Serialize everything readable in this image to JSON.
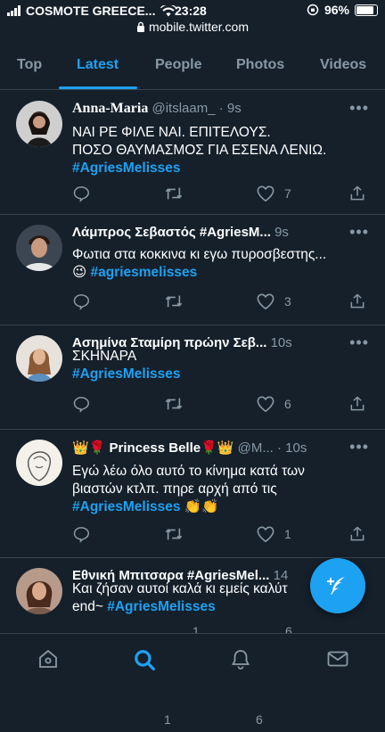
{
  "status_bar": {
    "carrier": "COSMOTE GREECE...",
    "time": "23:28",
    "battery": "96%",
    "battery_level": 0.96
  },
  "url": "mobile.twitter.com",
  "tabs": [
    {
      "label": "Top"
    },
    {
      "label": "Latest",
      "active": true
    },
    {
      "label": "People"
    },
    {
      "label": "Photos"
    },
    {
      "label": "Videos"
    }
  ],
  "tweets": [
    {
      "name": "Anna-Maria",
      "meta": "@itslaam_ · 9s",
      "lines": [
        "ΝΑΙ ΡΕ ΦΙΛΕ ΝΑΙ. ΕΠΙΤΕΛΟΥΣ.",
        "ΠΟΣΟ ΘΑΥΜΑΣΜΟΣ ΓΙΑ ΕΣΕΝΑ ΛΕΝΙΩ."
      ],
      "hashtag": "#AgriesMelisses",
      "likes": "7"
    },
    {
      "name": "Λάμπρος Σεβαστός #AgriesM...",
      "meta": "9s",
      "lines": [
        "Φωτια στα κοκκινα κι εγω πυροσβεστης..."
      ],
      "emoji": "😉",
      "hashtag": "#agriesmelisses",
      "likes": "3"
    },
    {
      "name": "Ασημίνα Σταμίρη πρώην Σεβ...",
      "meta": "10s",
      "lines": [
        "ΣΚΗΝΑΡΑ"
      ],
      "hashtag": "#AgriesMelisses",
      "likes": "6"
    },
    {
      "name": "Princess Belle",
      "name_prefix": "👑🌹",
      "name_suffix": "🌹👑",
      "meta": "@M... · 10s",
      "lines": [
        "Εγώ λέω όλο αυτό το κίνημα κατά των",
        "βιαστών κτλπ. πηρε αρχή από τις"
      ],
      "hashtag": "#AgriesMelisses",
      "emoji_after": "👏👏",
      "likes": "1"
    },
    {
      "name": "Εθνική Μπιτσαρα #AgriesMel...",
      "meta": "14",
      "lines": [
        "Και ζήσαν αυτοί καλά κι εμείς καλύτ"
      ],
      "line2_prefix": "end~",
      "hashtag": "#AgriesMelisses",
      "retweets": "1",
      "likes": "6"
    }
  ],
  "bottom_nav": [
    "home-icon",
    "search-icon",
    "notifications-icon",
    "messages-icon"
  ],
  "colors": {
    "background": "#15202b",
    "accent": "#1da1f2",
    "muted": "#8899a6",
    "divider": "#38444d"
  }
}
